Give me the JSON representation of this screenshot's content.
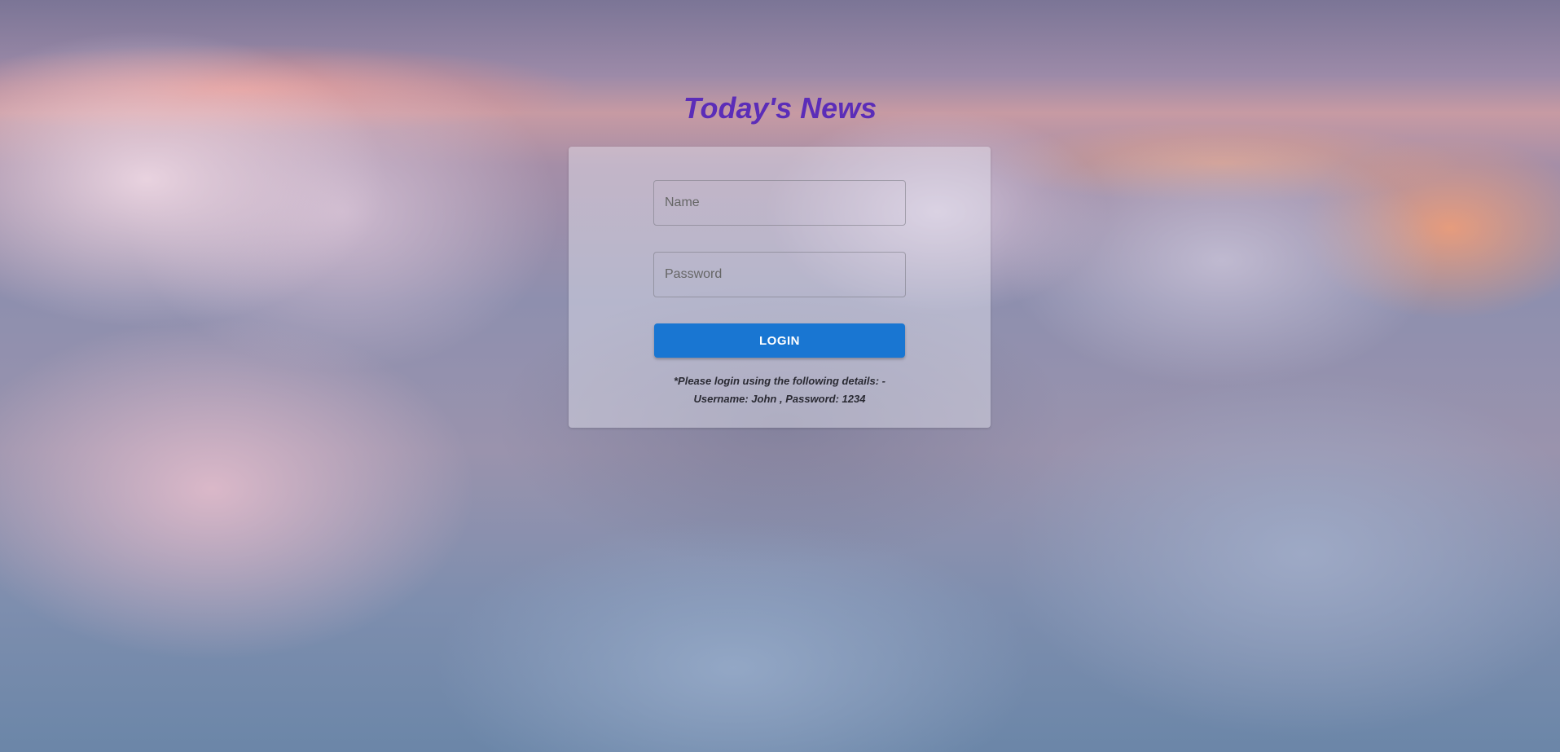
{
  "page": {
    "title": "Today's News"
  },
  "login_form": {
    "name_placeholder": "Name",
    "name_value": "",
    "password_placeholder": "Password",
    "password_value": "",
    "login_label": "LOGIN",
    "hint_line1": "*Please login using the following details: -",
    "hint_line2": "Username: John , Password: 1234"
  },
  "colors": {
    "title": "#5b2db8",
    "button": "#1976d2",
    "button_text": "#ffffff"
  }
}
